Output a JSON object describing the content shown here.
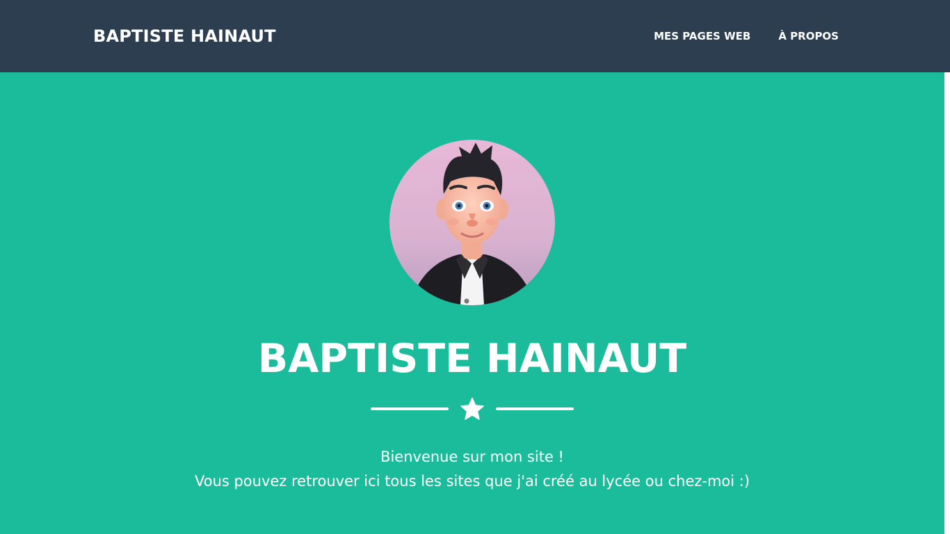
{
  "navbar": {
    "brand": "BAPTISTE HAINAUT",
    "links": [
      {
        "label": "MES PAGES WEB"
      },
      {
        "label": "À PROPOS"
      }
    ]
  },
  "hero": {
    "avatar_alt": "avatar-3d-portrait",
    "title": "BAPTISTE HAINAUT",
    "divider_icon": "star-icon",
    "lead_line1": "Bienvenue sur mon site !",
    "lead_line2": "Vous pouvez retrouver ici tous les sites que j'ai créé au lycée ou chez-moi :)"
  },
  "colors": {
    "navbar_bg": "#2c3e50",
    "masthead_bg": "#1abc9c",
    "text": "#ffffff"
  }
}
